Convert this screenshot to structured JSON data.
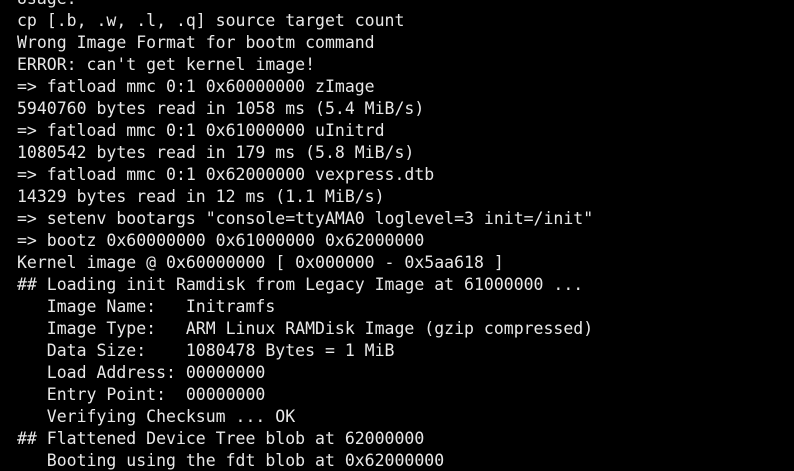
{
  "terminal": {
    "lines": [
      "Usage:",
      "cp [.b, .w, .l, .q] source target count",
      "Wrong Image Format for bootm command",
      "ERROR: can't get kernel image!",
      "=> fatload mmc 0:1 0x60000000 zImage",
      "5940760 bytes read in 1058 ms (5.4 MiB/s)",
      "=> fatload mmc 0:1 0x61000000 uInitrd",
      "1080542 bytes read in 179 ms (5.8 MiB/s)",
      "=> fatload mmc 0:1 0x62000000 vexpress.dtb",
      "14329 bytes read in 12 ms (1.1 MiB/s)",
      "=> setenv bootargs \"console=ttyAMA0 loglevel=3 init=/init\"",
      "=> bootz 0x60000000 0x61000000 0x62000000",
      "Kernel image @ 0x60000000 [ 0x000000 - 0x5aa618 ]",
      "## Loading init Ramdisk from Legacy Image at 61000000 ...",
      "   Image Name:   Initramfs",
      "   Image Type:   ARM Linux RAMDisk Image (gzip compressed)",
      "   Data Size:    1080478 Bytes = 1 MiB",
      "   Load Address: 00000000",
      "   Entry Point:  00000000",
      "   Verifying Checksum ... OK",
      "## Flattened Device Tree blob at 62000000",
      "   Booting using the fdt blob at 0x62000000"
    ],
    "colors": {
      "background": "#000000",
      "text": "#e8e8e8"
    }
  }
}
